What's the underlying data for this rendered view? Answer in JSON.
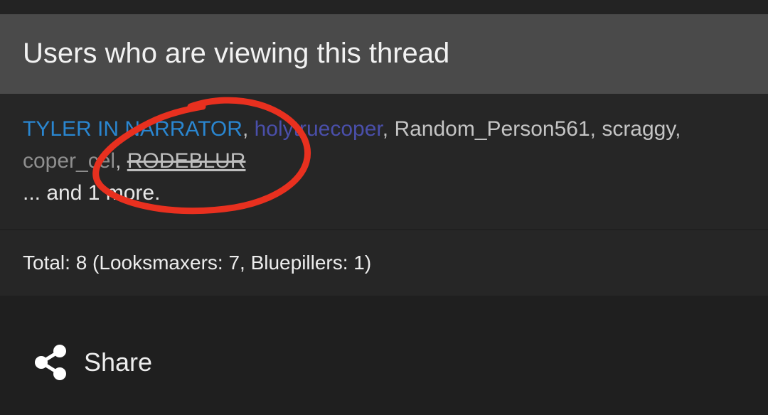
{
  "panel": {
    "title": "Users who are viewing this thread"
  },
  "users": [
    {
      "name": "TYLER IN NARRATOR",
      "color": "#2a86d0"
    },
    {
      "name": "holytruecoper",
      "color": "#4a4faa"
    },
    {
      "name": "Random_Person561",
      "color": "#c4c4c4"
    },
    {
      "name": "scraggy",
      "color": "#c4c4c4"
    },
    {
      "name": "coper_cel",
      "color": "#8f8f8f"
    },
    {
      "name": "RODEBLUR",
      "style": "strikethrough"
    }
  ],
  "separator": ",",
  "more_text": "... and 1 more.",
  "total_text": "Total: 8 (Looksmaxers: 7, Bluepillers: 1)",
  "share": {
    "label": "Share",
    "icon": "share-icon"
  },
  "annotation": {
    "type": "hand-drawn-circle",
    "color": "#e8301f"
  }
}
